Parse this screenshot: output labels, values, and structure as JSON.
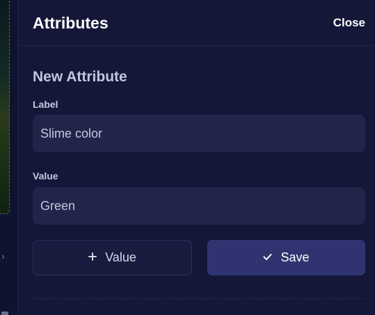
{
  "panel": {
    "title": "Attributes",
    "close_label": "Close"
  },
  "form": {
    "section_title": "New Attribute",
    "label_field": {
      "label": "Label",
      "value": "Slime color"
    },
    "value_field": {
      "label": "Value",
      "value": "Green"
    }
  },
  "actions": {
    "add_value_label": "Value",
    "add_value_icon": "plus-icon",
    "save_label": "Save",
    "save_icon": "check-icon"
  },
  "sidebar": {
    "expand_icon": "chevron-right-icon"
  },
  "colors": {
    "panel_bg": "#141738",
    "input_bg": "#22254a",
    "primary_button": "#2f3470",
    "secondary_button": "#191c3f"
  }
}
